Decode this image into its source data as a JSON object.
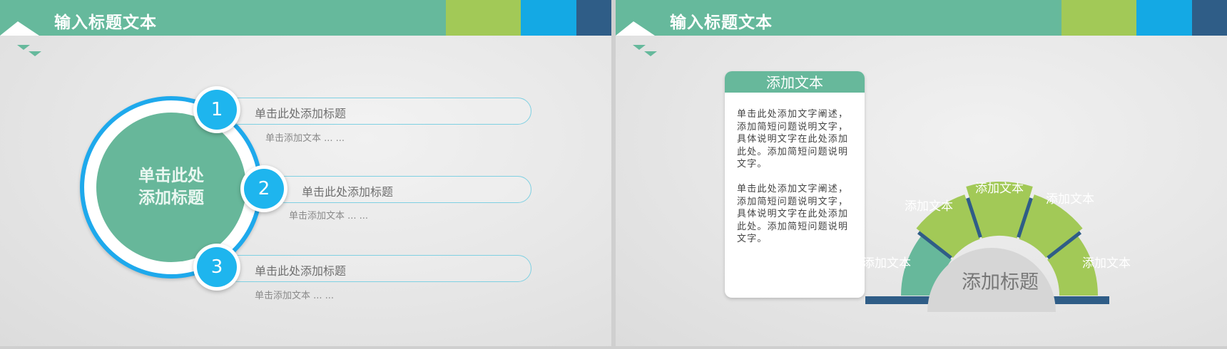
{
  "slides": [
    {
      "header_title": "输入标题文本",
      "center_title": "单击此处添加标题",
      "items": [
        {
          "number": "1",
          "title": "单击此处添加标题",
          "subtitle": "单击添加文本 ... ..."
        },
        {
          "number": "2",
          "title": "单击此处添加标题",
          "subtitle": "单击添加文本 ... ..."
        },
        {
          "number": "3",
          "title": "单击此处添加标题",
          "subtitle": "单击添加文本 ... ..."
        }
      ]
    },
    {
      "header_title": "输入标题文本",
      "card": {
        "title": "添加文本",
        "para1": "单击此处添加文字阐述，添加简短问题说明文字，具体说明文字在此处添加此处。添加简短问题说明文字。",
        "para2": "单击此处添加文字阐述，添加简短问题说明文字，具体说明文字在此处添加此处。添加简短问题说明文字。"
      },
      "fan": {
        "center_title": "添加标题",
        "segments": [
          "添加文本",
          "添加文本",
          "添加文本",
          "添加文本",
          "添加文本"
        ]
      }
    }
  ],
  "colors": {
    "teal": "#66b99c",
    "lime": "#a2c957",
    "blue": "#14a9e4",
    "navy": "#2f5d87"
  }
}
